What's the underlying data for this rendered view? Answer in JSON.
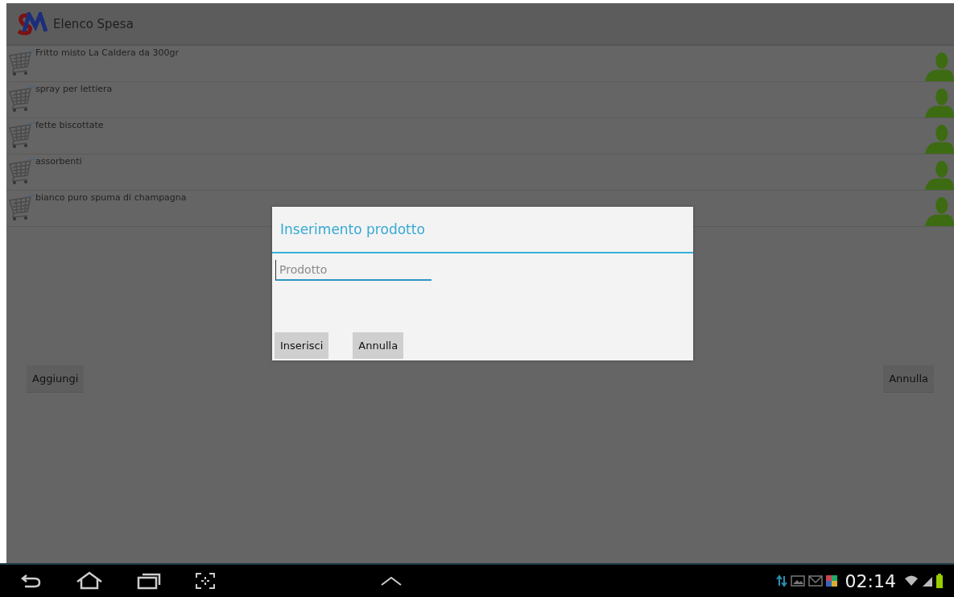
{
  "app_bar": {
    "title": "Elenco Spesa"
  },
  "list": {
    "items": [
      {
        "name": "Fritto misto La Caldera  da 300gr"
      },
      {
        "name": "spray per lettiera"
      },
      {
        "name": "fette biscottate"
      },
      {
        "name": "assorbenti"
      },
      {
        "name": "bianco puro spuma di champagna"
      }
    ]
  },
  "actions": [
    {
      "label": "Aggiungi"
    },
    {
      "label": "Annulla"
    }
  ],
  "dialog": {
    "title": "Inserimento prodotto",
    "field": {
      "placeholder": "Prodotto"
    },
    "buttons": [
      {
        "label": "Inserisci"
      },
      {
        "label": "Annulla"
      }
    ]
  },
  "status_bar": {
    "time": "02:14"
  }
}
